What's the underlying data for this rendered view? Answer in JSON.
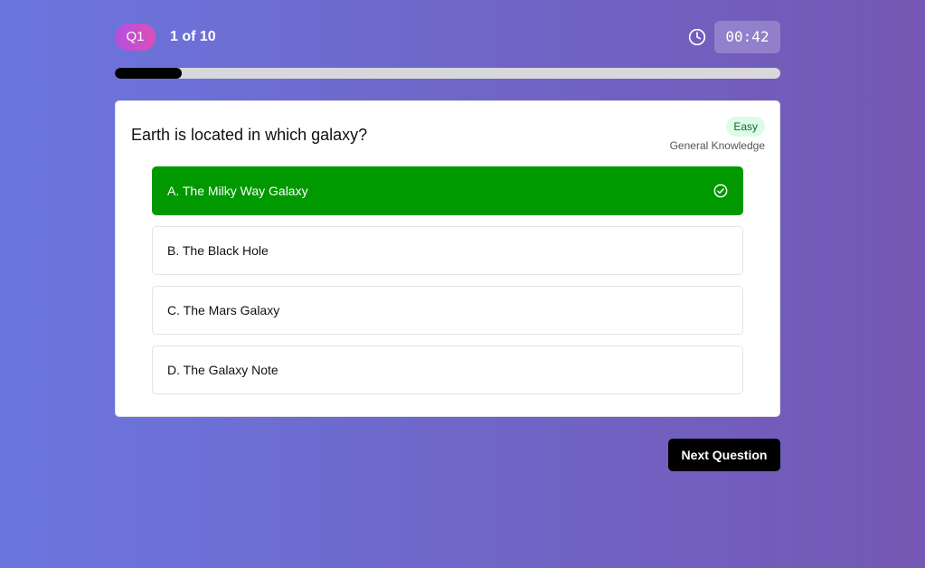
{
  "header": {
    "question_badge": "Q1",
    "progress_text": "1 of 10",
    "timer": "00:42",
    "timer_icon": "clock-icon"
  },
  "progress": {
    "current": 1,
    "total": 10,
    "fraction": 0.1
  },
  "question": {
    "text": "Earth is located in which galaxy?",
    "difficulty": "Easy",
    "category": "General Knowledge",
    "options": [
      {
        "label": "A. The Milky Way Galaxy",
        "state": "correct",
        "icon": "check-circle-icon"
      },
      {
        "label": "B. The Black Hole",
        "state": "default"
      },
      {
        "label": "C. The Mars Galaxy",
        "state": "default"
      },
      {
        "label": "D. The Galaxy Note",
        "state": "default"
      }
    ]
  },
  "actions": {
    "next_label": "Next Question"
  },
  "colors": {
    "background_start": "#6b76df",
    "background_end": "#7457b3",
    "correct": "#009900",
    "difficulty_bg": "#dcfce7",
    "difficulty_text": "#166534",
    "badge_start": "#b44fe0",
    "badge_end": "#dd4fb8"
  }
}
